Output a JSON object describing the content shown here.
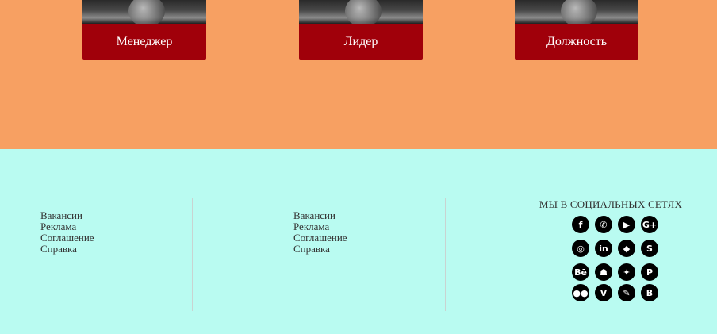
{
  "cards": [
    {
      "label": "Менеджер"
    },
    {
      "label": "Лидер"
    },
    {
      "label": "Должность"
    }
  ],
  "footer": {
    "columns": [
      {
        "links": [
          "Вакансии",
          "Реклама",
          "Соглашение",
          "Справка"
        ]
      },
      {
        "links": [
          "Вакансии",
          "Реклама",
          "Соглашение",
          "Справка"
        ]
      }
    ],
    "social": {
      "title": "МЫ В СОЦИАЛЬНЫХ СЕТЯХ",
      "icons": [
        {
          "name": "facebook-icon",
          "glyph": "f"
        },
        {
          "name": "whatsapp-icon",
          "glyph": "✆"
        },
        {
          "name": "youtube-icon",
          "glyph": "▶"
        },
        {
          "name": "google-plus-icon",
          "glyph": "G+"
        },
        {
          "name": "instagram-icon",
          "glyph": "◎"
        },
        {
          "name": "linkedin-icon",
          "glyph": "in"
        },
        {
          "name": "dropbox-icon",
          "glyph": "◆"
        },
        {
          "name": "skype-icon",
          "glyph": "S"
        },
        {
          "name": "behance-icon",
          "glyph": "Bē"
        },
        {
          "name": "snapchat-icon",
          "glyph": "☗"
        },
        {
          "name": "twitter-icon",
          "glyph": "✦"
        },
        {
          "name": "pinterest-icon",
          "glyph": "P"
        },
        {
          "name": "flickr-icon",
          "glyph": "●●"
        },
        {
          "name": "vimeo-icon",
          "glyph": "V"
        },
        {
          "name": "evernote-icon",
          "glyph": "✎"
        },
        {
          "name": "blogger-icon",
          "glyph": "B"
        }
      ]
    }
  }
}
